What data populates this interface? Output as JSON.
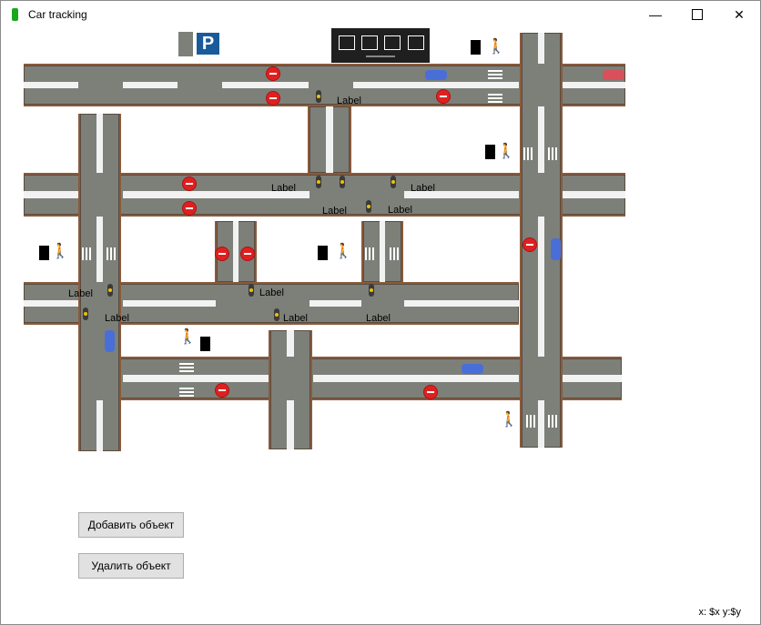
{
  "window": {
    "title": "Car tracking",
    "min_icon": "minimize-icon",
    "max_icon": "maximize-icon",
    "close_icon": "close-icon"
  },
  "map": {
    "parking_letter": "P",
    "labels": [
      "Label",
      "Label",
      "Label",
      "Label",
      "Label",
      "Label",
      "Label",
      "Label",
      "Label",
      "Label"
    ]
  },
  "buttons": {
    "add": "Добавить объект",
    "remove": "Удалить объект"
  },
  "status": {
    "coords": "x: $x y:$y"
  },
  "colors": {
    "road": "#7c8079",
    "curb": "#8a5a3c",
    "noentry": "#e02020",
    "toolbar": "#1f1f1f",
    "parking": "#1a5a9a"
  }
}
